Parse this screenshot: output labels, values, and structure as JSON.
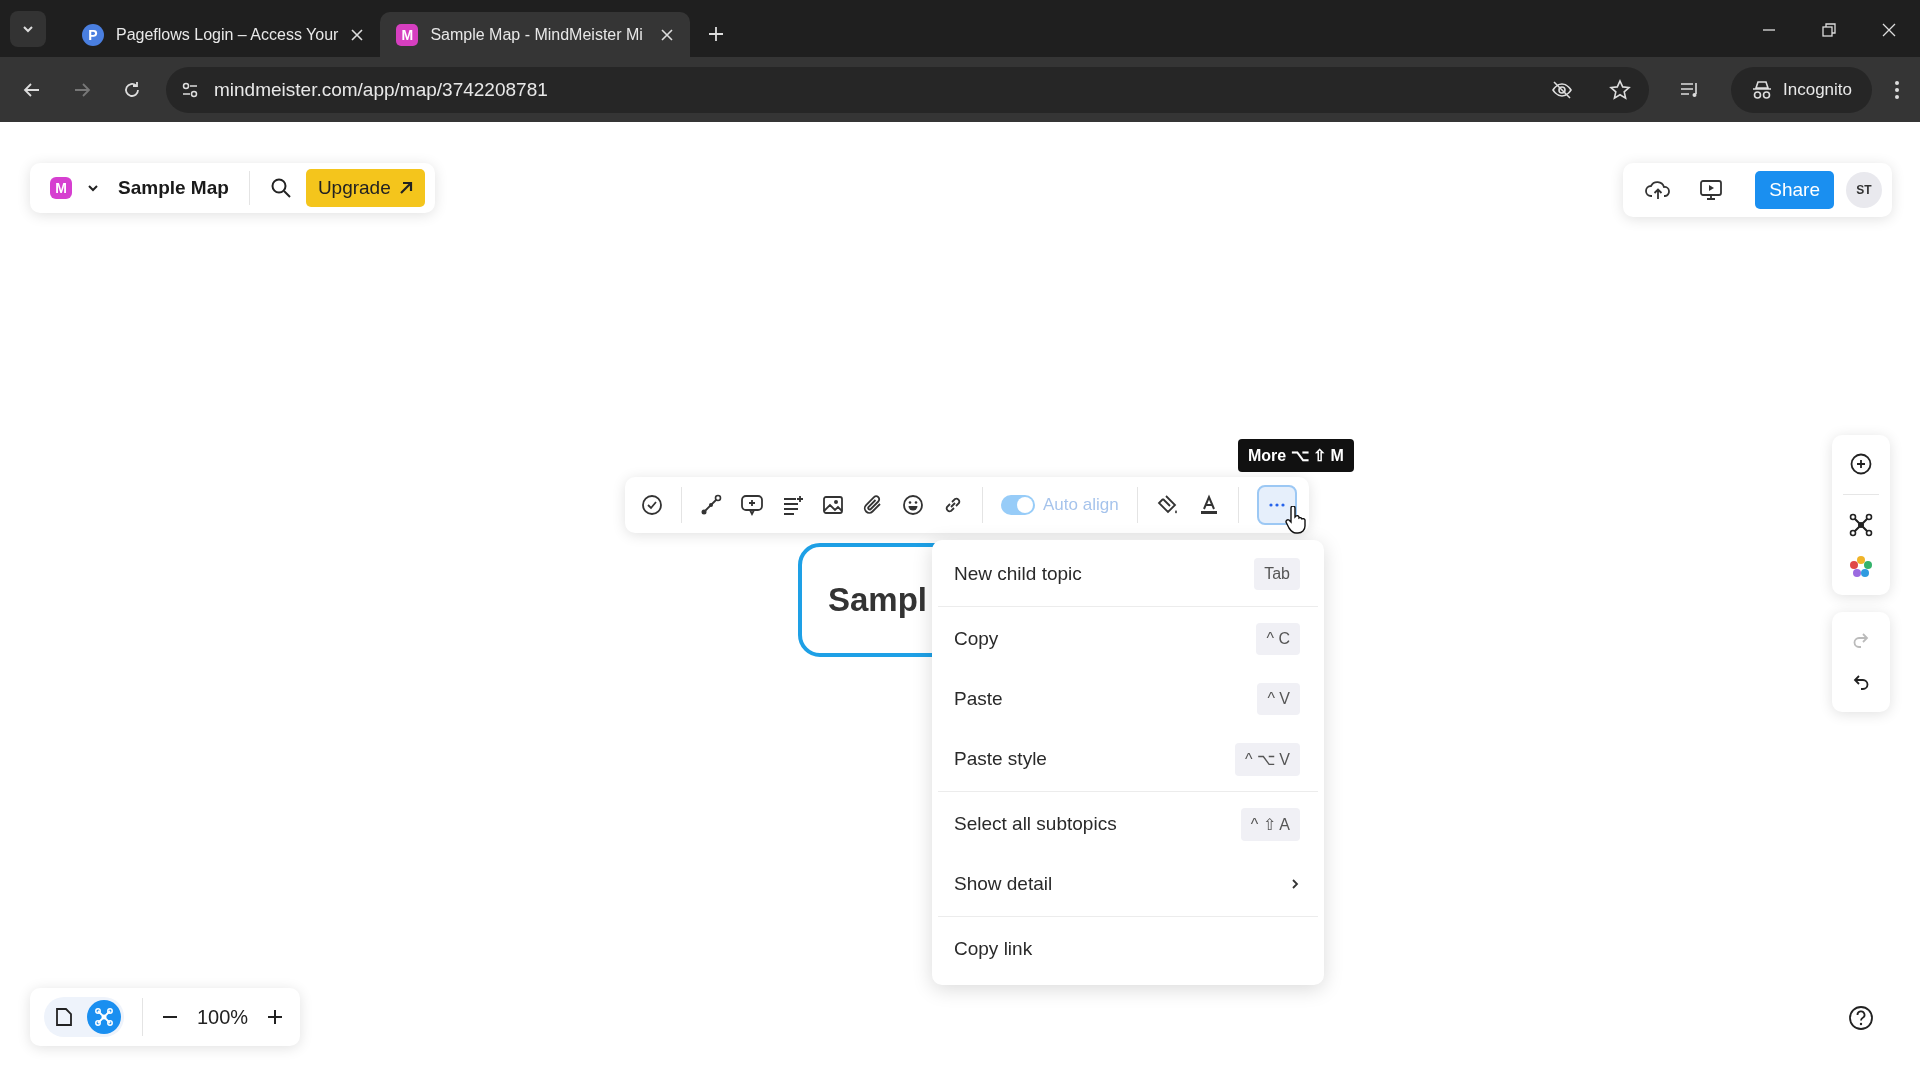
{
  "browser": {
    "tabs": [
      {
        "favicon": "P",
        "title": "Pageflows Login – Access Your",
        "selected": false
      },
      {
        "favicon": "M",
        "title": "Sample Map - MindMeister Mi",
        "selected": true
      }
    ],
    "url": "mindmeister.com/app/map/3742208781",
    "profile": "Incognito"
  },
  "header": {
    "logo": "M",
    "map_title": "Sample Map",
    "upgrade": "Upgrade",
    "share": "Share",
    "avatar": "ST"
  },
  "toolbar": {
    "auto_align": {
      "label": "Auto align",
      "on": true,
      "disabled": true
    },
    "more_selected": true,
    "tooltip": "More ⌥ ⇧ M"
  },
  "node": {
    "text": "Sampl"
  },
  "menu": {
    "sections": [
      [
        {
          "label": "New child topic",
          "kind": "shortcut",
          "shortcut": "Tab"
        }
      ],
      [
        {
          "label": "Copy",
          "kind": "shortcut",
          "shortcut": "^ C"
        },
        {
          "label": "Paste",
          "kind": "shortcut",
          "shortcut": "^ V"
        },
        {
          "label": "Paste style",
          "kind": "shortcut",
          "shortcut": "^ ⌥ V"
        }
      ],
      [
        {
          "label": "Select all subtopics",
          "kind": "shortcut",
          "shortcut": "^ ⇧ A"
        },
        {
          "label": "Show detail",
          "kind": "submenu"
        }
      ],
      [
        {
          "label": "Copy link",
          "kind": "plain"
        }
      ]
    ]
  },
  "history": [
    {
      "kind": "redo",
      "disabled": true
    },
    {
      "kind": "undo",
      "disabled": false
    }
  ],
  "view_modes": [
    {
      "kind": "outline",
      "selected": false
    },
    {
      "kind": "mindmap",
      "selected": true
    }
  ],
  "zoom": "100%"
}
